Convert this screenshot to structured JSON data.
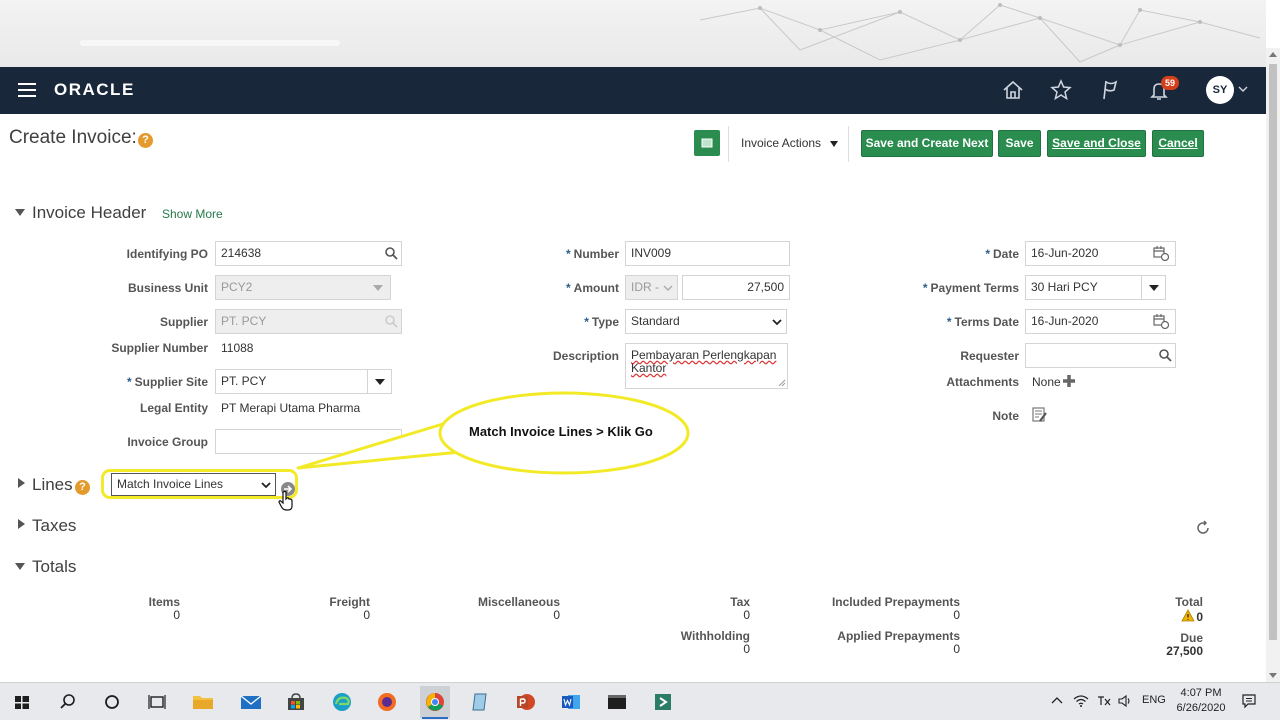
{
  "header": {
    "logo": "ORACLE",
    "notification_count": "59",
    "avatar_initials": "SY"
  },
  "page": {
    "title": "Create Invoice:",
    "help": "?"
  },
  "toolbar": {
    "invoice_actions": "Invoice Actions",
    "save_create_next": "Save and Create Next",
    "save": "Save",
    "save_close": "Save and Close",
    "cancel": "Cancel"
  },
  "invoice_header": {
    "title": "Invoice Header",
    "show_more": "Show More",
    "fields": {
      "identifying_po": {
        "label": "Identifying PO",
        "value": "214638"
      },
      "business_unit": {
        "label": "Business Unit",
        "value": "PCY2"
      },
      "supplier": {
        "label": "Supplier",
        "value": "PT. PCY"
      },
      "supplier_number": {
        "label": "Supplier Number",
        "value": "11088"
      },
      "supplier_site": {
        "label": "Supplier Site",
        "value": "PT. PCY"
      },
      "legal_entity": {
        "label": "Legal Entity",
        "value": "PT Merapi Utama Pharma"
      },
      "invoice_group": {
        "label": "Invoice Group",
        "value": ""
      },
      "number": {
        "label": "Number",
        "value": "INV009"
      },
      "amount": {
        "label": "Amount",
        "currency": "IDR -",
        "value": "27,500"
      },
      "type": {
        "label": "Type",
        "value": "Standard"
      },
      "description": {
        "label": "Description",
        "value_line1": "Pembayaran Perlengkapan",
        "value_line2": "Kantor"
      },
      "date": {
        "label": "Date",
        "value": "16-Jun-2020"
      },
      "payment_terms": {
        "label": "Payment Terms",
        "value": "30 Hari PCY"
      },
      "terms_date": {
        "label": "Terms Date",
        "value": "16-Jun-2020"
      },
      "requester": {
        "label": "Requester",
        "value": ""
      },
      "attachments": {
        "label": "Attachments",
        "value": "None"
      },
      "note": {
        "label": "Note"
      }
    },
    "required_mark": "*"
  },
  "callout": {
    "text": "Match Invoice Lines > Klik Go"
  },
  "lines": {
    "title": "Lines",
    "select_value": "Match Invoice Lines"
  },
  "taxes": {
    "title": "Taxes"
  },
  "totals": {
    "title": "Totals",
    "items": {
      "label": "Items",
      "value": "0"
    },
    "freight": {
      "label": "Freight",
      "value": "0"
    },
    "misc": {
      "label": "Miscellaneous",
      "value": "0"
    },
    "tax": {
      "label": "Tax",
      "value": "0"
    },
    "withholding": {
      "label": "Withholding",
      "value": "0"
    },
    "included_prepayments": {
      "label": "Included Prepayments",
      "value": "0"
    },
    "applied_prepayments": {
      "label": "Applied Prepayments",
      "value": "0"
    },
    "total": {
      "label": "Total",
      "value": "0"
    },
    "due": {
      "label": "Due",
      "value": "27,500"
    }
  },
  "taskbar": {
    "language": "ENG",
    "time": "4:07 PM",
    "date": "6/26/2020"
  },
  "colors": {
    "header_bg": "#19273a",
    "primary_button": "#2a8c4f",
    "callout_border": "#f2ea27",
    "badge": "#d4401b"
  }
}
